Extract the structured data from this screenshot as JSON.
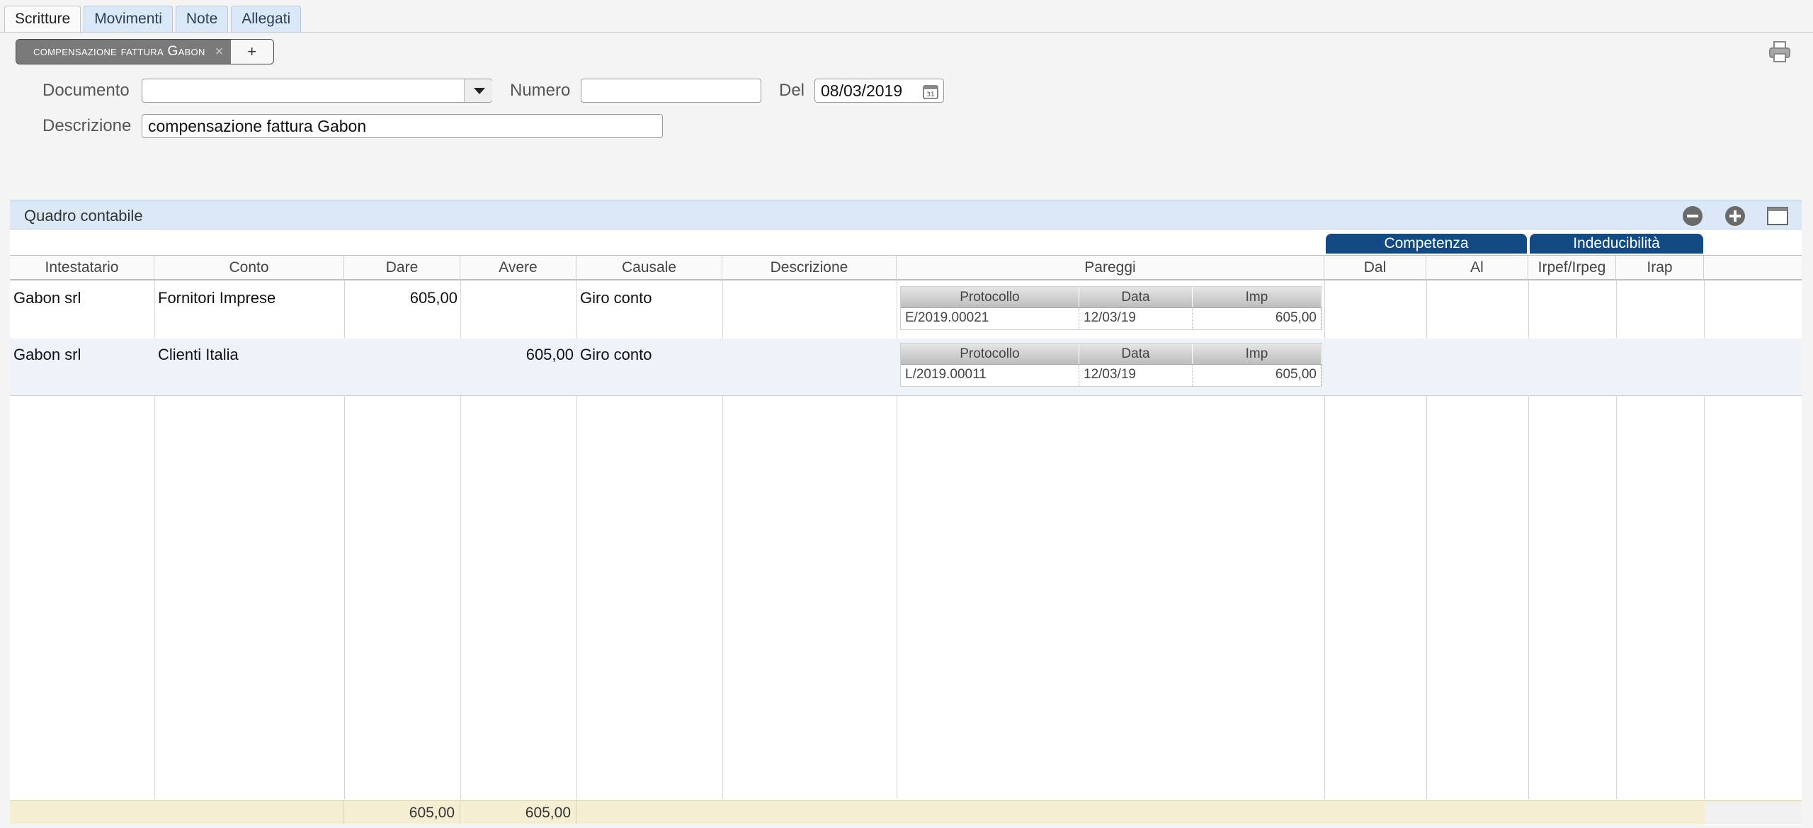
{
  "tabs": [
    {
      "label": "Scritture",
      "active": true
    },
    {
      "label": "Movimenti",
      "active": false
    },
    {
      "label": "Note",
      "active": false
    },
    {
      "label": "Allegati",
      "active": false
    }
  ],
  "document_pill": {
    "label": "compensazione fattura Gabon",
    "close": "×",
    "add": "+"
  },
  "form": {
    "documento_label": "Documento",
    "documento_value": "",
    "numero_label": "Numero",
    "numero_value": "",
    "del_label": "Del",
    "del_value": "08/03/2019",
    "descrizione_label": "Descrizione",
    "descrizione_value": "compensazione fattura Gabon"
  },
  "section": {
    "title": "Quadro contabile"
  },
  "groups": {
    "competenza": "Competenza",
    "indeducibilita": "Indeducibilità"
  },
  "columns": [
    "Intestatario",
    "Conto",
    "Dare",
    "Avere",
    "Causale",
    "Descrizione",
    "Pareggi",
    "Dal",
    "Al",
    "Irpef/Irpeg",
    "Irap"
  ],
  "mini_columns": [
    "Protocollo",
    "Data",
    "Imp"
  ],
  "rows": [
    {
      "intestatario": "Gabon srl",
      "conto": "Fornitori Imprese",
      "dare": "605,00",
      "avere": "",
      "causale": "Giro conto",
      "descrizione": "",
      "pareggio": {
        "protocollo": "E/2019.00021",
        "data": "12/03/19",
        "imp": "605,00"
      }
    },
    {
      "intestatario": "Gabon srl",
      "conto": "Clienti Italia",
      "dare": "",
      "avere": "605,00",
      "causale": "Giro conto",
      "descrizione": "",
      "pareggio": {
        "protocollo": "L/2019.00011",
        "data": "12/03/19",
        "imp": "605,00"
      }
    }
  ],
  "totals": {
    "dare": "605,00",
    "avere": "605,00"
  }
}
